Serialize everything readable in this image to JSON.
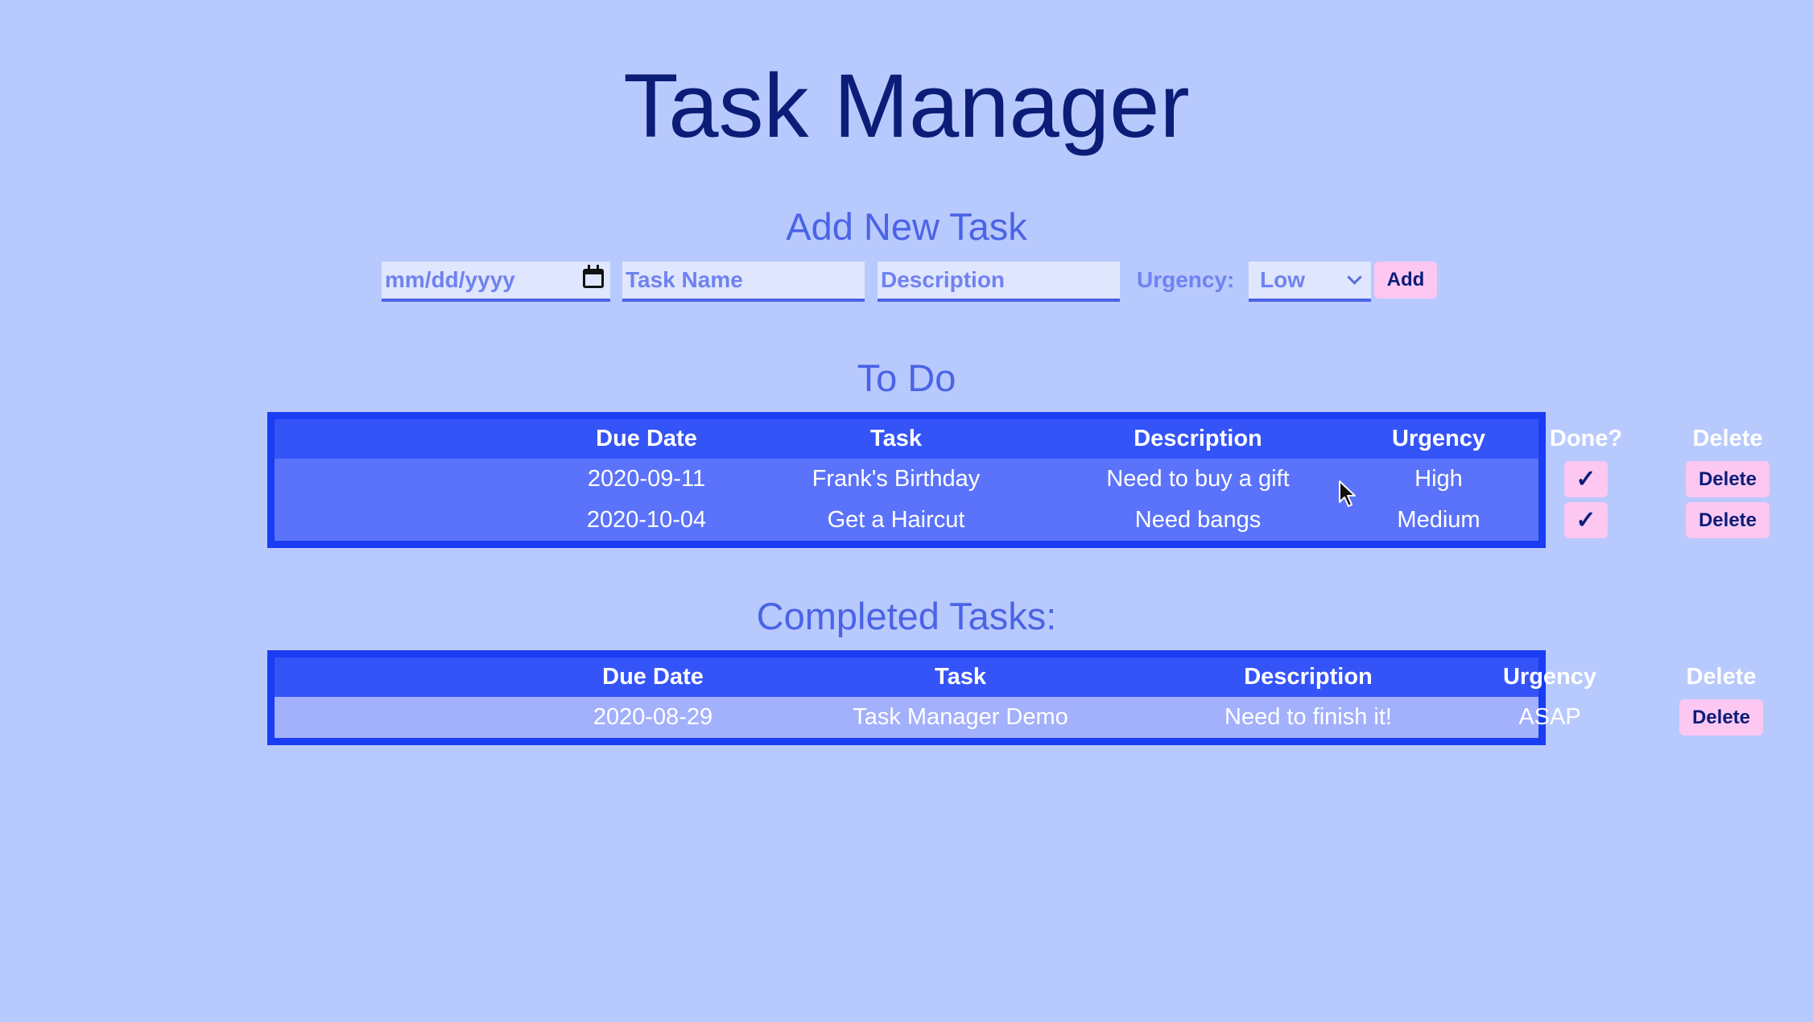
{
  "title": "Task Manager",
  "add_section": {
    "heading": "Add New Task",
    "date_placeholder": "mm/dd/yyyy",
    "task_name_placeholder": "Task Name",
    "description_placeholder": "Description",
    "urgency_label": "Urgency:",
    "urgency_selected": "Low",
    "add_label": "Add"
  },
  "todo": {
    "heading": "To Do",
    "columns": [
      "Due Date",
      "Task",
      "Description",
      "Urgency",
      "Done?",
      "Delete"
    ],
    "rows": [
      {
        "due": "2020-09-11",
        "task": "Frank's Birthday",
        "description": "Need to buy a gift",
        "urgency": "High",
        "done_label": "✓",
        "delete_label": "Delete"
      },
      {
        "due": "2020-10-04",
        "task": "Get a Haircut",
        "description": "Need bangs",
        "urgency": "Medium",
        "done_label": "✓",
        "delete_label": "Delete"
      }
    ]
  },
  "completed": {
    "heading": "Completed Tasks:",
    "columns": [
      "Due Date",
      "Task",
      "Description",
      "Urgency",
      "Delete"
    ],
    "rows": [
      {
        "due": "2020-08-29",
        "task": "Task Manager Demo",
        "description": "Need to finish it!",
        "urgency": "ASAP",
        "delete_label": "Delete"
      }
    ]
  },
  "colors": {
    "background": "#b8c9fd",
    "title": "#0c1d78",
    "heading": "#4b63e6",
    "table_border": "#1a3cf3",
    "table_header": "#3554f8",
    "todo_row": "#5b73fa",
    "completed_row": "#a3b0fb",
    "button": "#fcc8f2"
  }
}
